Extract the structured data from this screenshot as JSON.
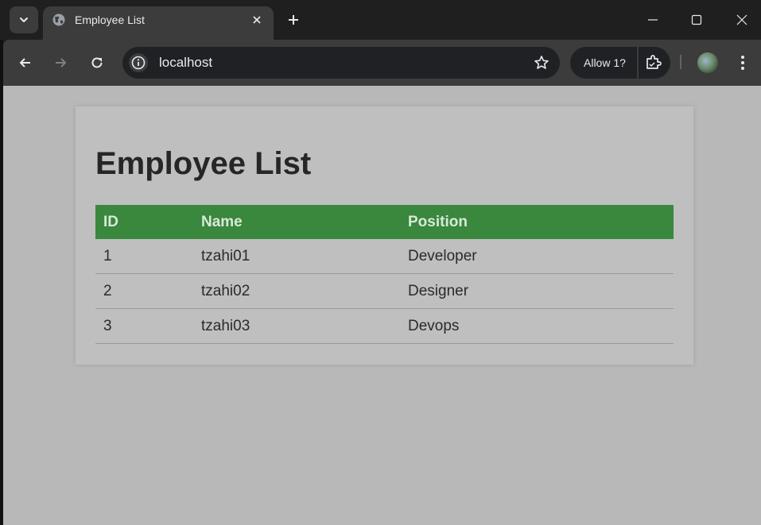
{
  "browser": {
    "tab": {
      "title": "Employee List",
      "favicon": "globe-icon",
      "close_icon": "close-icon"
    },
    "new_tab_icon": "plus-icon",
    "window_controls": [
      "minimize-icon",
      "maximize-icon",
      "close-icon"
    ],
    "toolbar": {
      "back_icon": "arrow-left-icon",
      "forward_icon": "arrow-right-icon",
      "reload_icon": "reload-icon",
      "site_info_icon": "info-icon",
      "url": "localhost",
      "bookmark_icon": "star-icon",
      "permission_label": "Allow 1?",
      "extension_icon": "extension-icon",
      "menu_icon": "more-vert-icon"
    },
    "colors": {
      "tab_strip": "#1f1f1f",
      "toolbar": "#3c3c3c",
      "omnibox": "#202124"
    }
  },
  "page": {
    "title": "Employee List",
    "table": {
      "columns": [
        "ID",
        "Name",
        "Position"
      ],
      "rows": [
        [
          "1",
          "tzahi01",
          "Developer"
        ],
        [
          "2",
          "tzahi02",
          "Designer"
        ],
        [
          "3",
          "tzahi03",
          "Devops"
        ]
      ]
    },
    "colors": {
      "page_background": "#b8b8b8",
      "card_background": "#bfbfbf",
      "header_background": "#3a873e",
      "header_text": "#d8e9d8"
    }
  }
}
